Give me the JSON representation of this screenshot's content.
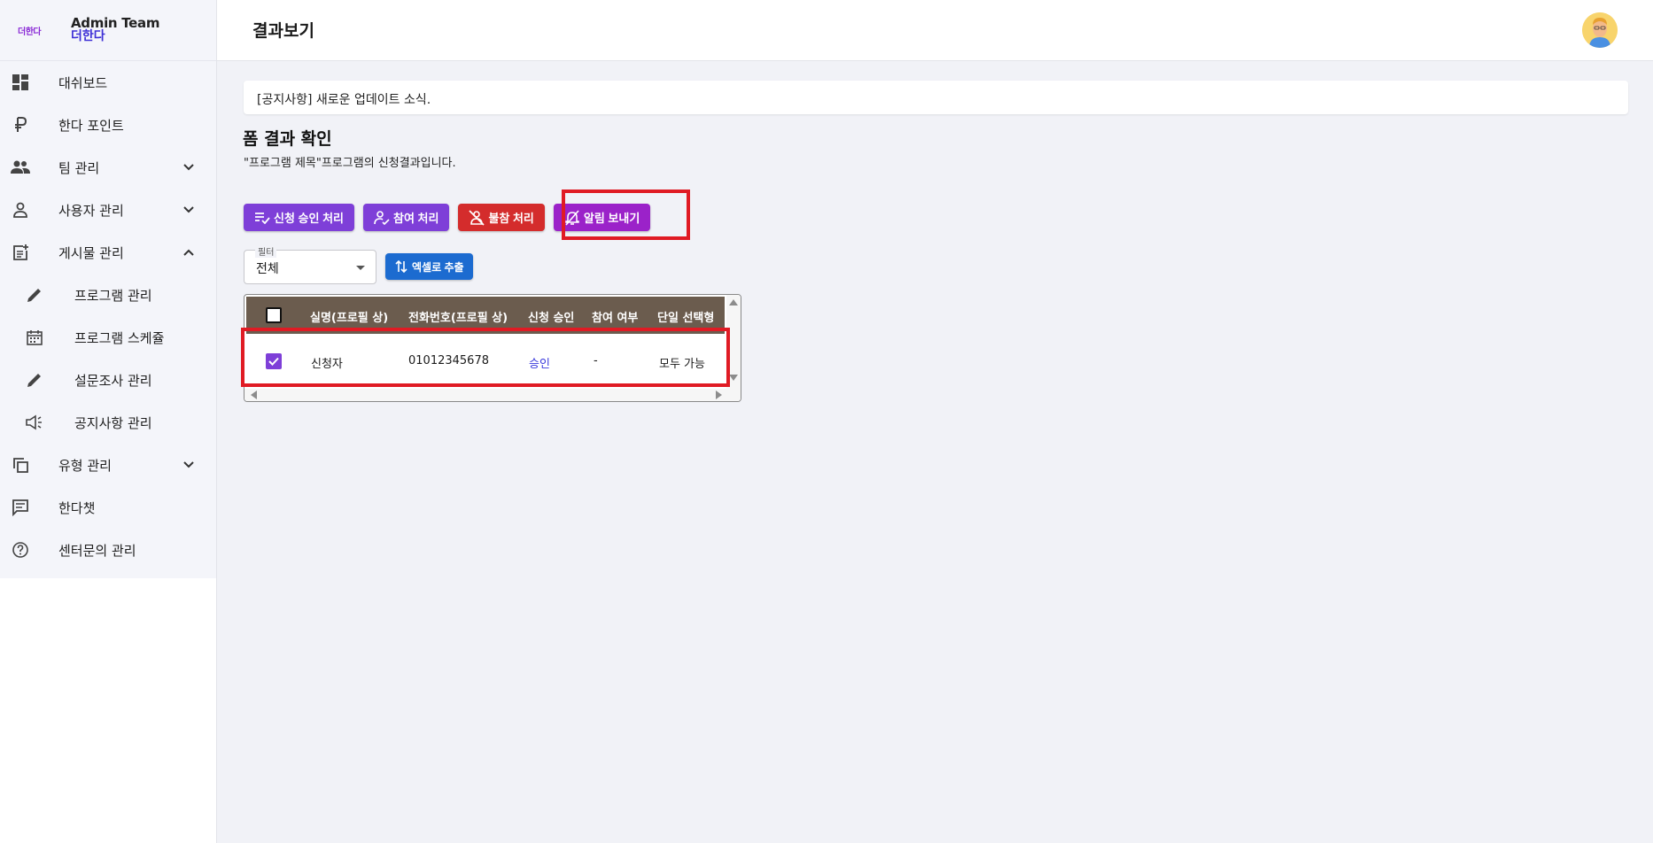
{
  "brand": {
    "logo_text": "더한다",
    "team": "Admin Team",
    "sub": "더한다"
  },
  "sidebar": {
    "items": [
      {
        "label": "대쉬보드",
        "icon": "dashboard-icon"
      },
      {
        "label": "한다 포인트",
        "icon": "currency-icon"
      },
      {
        "label": "팀 관리",
        "icon": "group-icon",
        "expand": "chevron-down-icon"
      },
      {
        "label": "사용자 관리",
        "icon": "person-icon",
        "expand": "chevron-down-icon"
      },
      {
        "label": "게시물 관리",
        "icon": "post-add-icon",
        "expand": "chevron-up-icon"
      },
      {
        "label": "프로그램 관리",
        "icon": "pencil-icon"
      },
      {
        "label": "프로그램 스케쥴",
        "icon": "calendar-icon"
      },
      {
        "label": "설문조사 관리",
        "icon": "pencil-icon"
      },
      {
        "label": "공지사항 관리",
        "icon": "megaphone-icon"
      },
      {
        "label": "유형 관리",
        "icon": "copy-icon",
        "expand": "chevron-down-icon"
      },
      {
        "label": "한다챗",
        "icon": "chat-icon"
      },
      {
        "label": "센터문의 관리",
        "icon": "help-icon"
      }
    ]
  },
  "header": {
    "title": "결과보기"
  },
  "notice": {
    "text": "[공지사항] 새로운 업데이트 소식."
  },
  "main": {
    "title": "폼 결과 확인",
    "description": "\"프로그램 제목\"프로그램의 신청결과입니다."
  },
  "toolbar": {
    "approve_label": "신청 승인 처리",
    "attend_label": "참여 처리",
    "absent_label": "불참 처리",
    "notify_label": "알림 보내기"
  },
  "filter": {
    "label": "필터",
    "value": "전체"
  },
  "export": {
    "label": "엑셀로 추출"
  },
  "table": {
    "columns": [
      "실명(프로필 상)",
      "전화번호(프로필 상)",
      "신청 승인",
      "참여 여부",
      "단일 선택형"
    ],
    "rows": [
      {
        "checked": true,
        "name": "신청자",
        "phone": "01012345678",
        "approval": "승인",
        "attendance": "-",
        "single_choice": "모두 가능"
      }
    ]
  },
  "colors": {
    "purple": "#7e3fd8",
    "red": "#d42c2c",
    "magenta": "#9b22c9",
    "blue": "#1c6bd0",
    "table_header": "#6b5c4e",
    "highlight": "#e01b24"
  }
}
